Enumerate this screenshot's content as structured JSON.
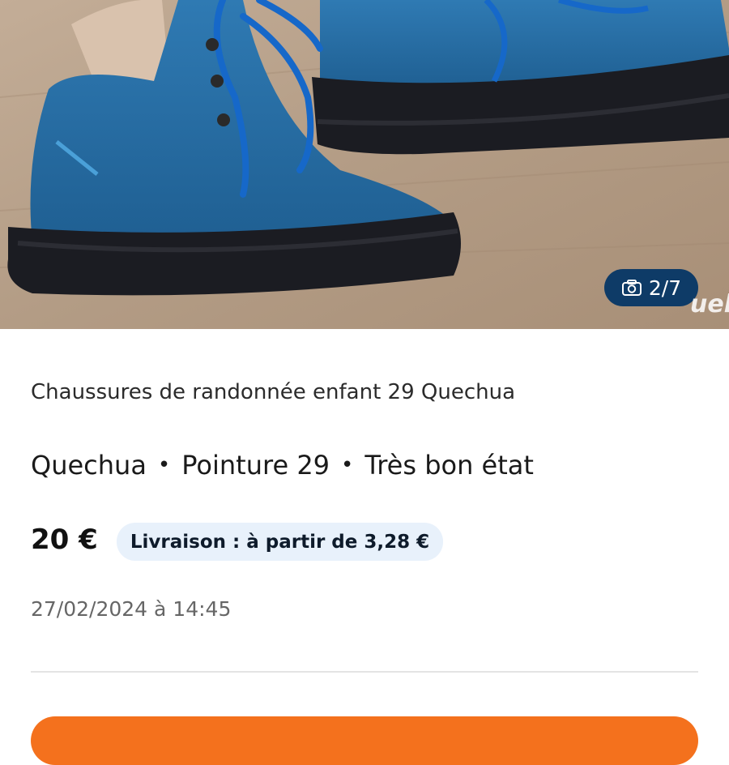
{
  "listing": {
    "photo": {
      "description_icon": "camera-icon",
      "counter": "2/7",
      "watermark": "ueb"
    },
    "title": "Chaussures de randonnée enfant 29 Quechua",
    "attributes": {
      "brand": "Quechua",
      "separator": "•",
      "size": "Pointure 29",
      "condition": "Très bon état"
    },
    "price": "20 €",
    "delivery": "Livraison : à partir de 3,28 €",
    "date": "27/02/2024 à 14:45",
    "cta_color": "#f4711d",
    "accent_color": "#0e3b67"
  }
}
